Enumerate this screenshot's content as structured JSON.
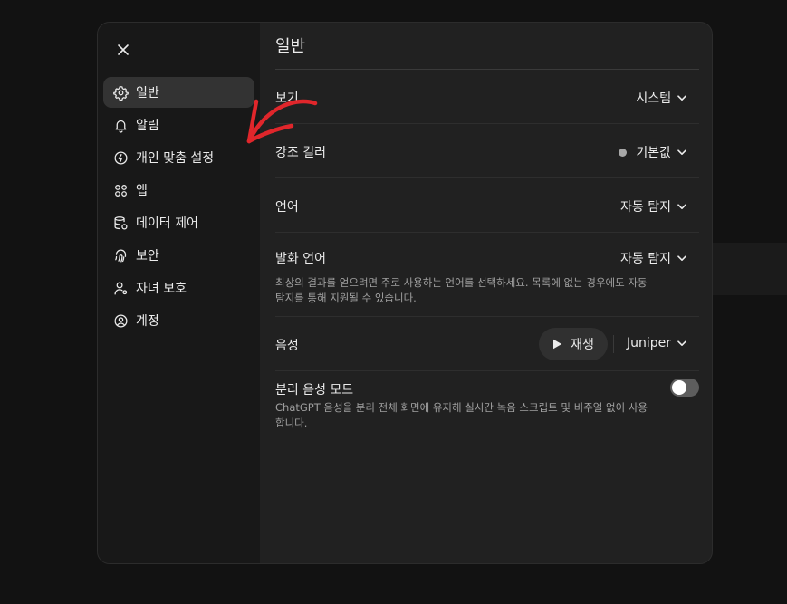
{
  "sidebar": {
    "close_label": "close",
    "items": [
      {
        "label": "일반",
        "icon": "gear-icon",
        "active": true
      },
      {
        "label": "알림",
        "icon": "bell-icon",
        "active": false
      },
      {
        "label": "개인 맞춤 설정",
        "icon": "personalization-icon",
        "active": false
      },
      {
        "label": "앱",
        "icon": "apps-grid-icon",
        "active": false
      },
      {
        "label": "데이터 제어",
        "icon": "database-icon",
        "active": false
      },
      {
        "label": "보안",
        "icon": "fingerprint-icon",
        "active": false
      },
      {
        "label": "자녀 보호",
        "icon": "parental-control-icon",
        "active": false
      },
      {
        "label": "계정",
        "icon": "account-icon",
        "active": false
      }
    ]
  },
  "main": {
    "title": "일반",
    "appearance": {
      "label": "보기",
      "value": "시스템"
    },
    "accent_color": {
      "label": "강조 컬러",
      "value": "기본값",
      "swatch": "#a8a8a8"
    },
    "language": {
      "label": "언어",
      "value": "자동 탐지"
    },
    "spoken_language": {
      "label": "발화 언어",
      "value": "자동 탐지",
      "description": "최상의 결과를 얻으려면 주로 사용하는 언어를 선택하세요. 목록에 없는 경우에도 자동 탐지를 통해 지원될 수 있습니다."
    },
    "voice": {
      "label": "음성",
      "play_label": "재생",
      "value": "Juniper"
    },
    "separate_voice_mode": {
      "label": "분리 음성 모드",
      "description": "ChatGPT 음성을 분리 전체 화면에 유지해 실시간 녹음 스크립트 및 비주얼 없이 사용합니다.",
      "enabled": false
    }
  },
  "colors": {
    "background": "#121212",
    "modal": "#212121",
    "sidebar": "#181818",
    "active_item": "#333333",
    "annotation_arrow": "#e0262b"
  }
}
